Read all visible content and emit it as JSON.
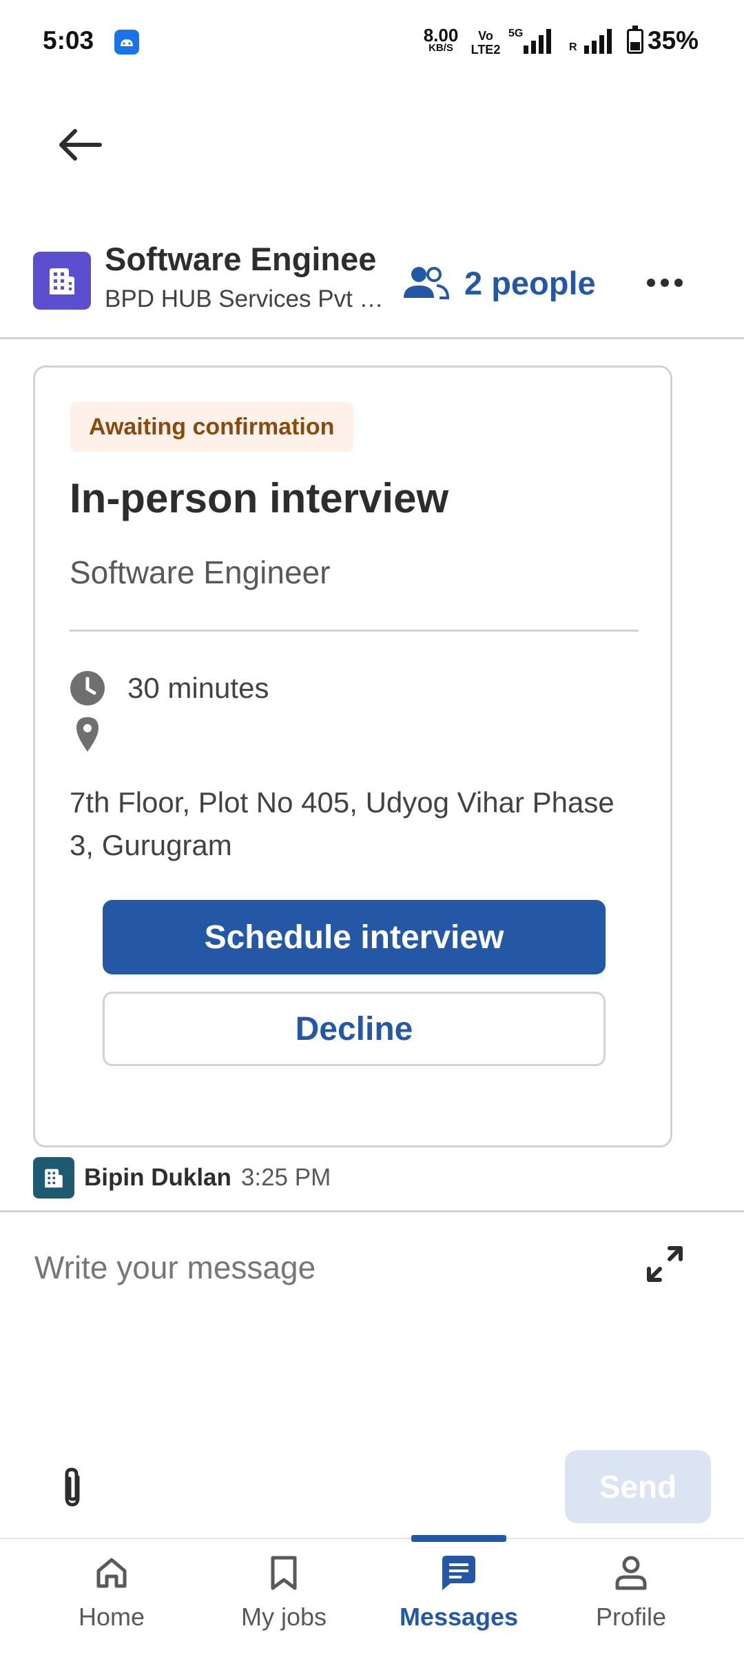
{
  "status_bar": {
    "time": "5:03",
    "network_speed": "8.00",
    "network_speed_unit": "KB/S",
    "volte": "Vo",
    "lte": "LTE2",
    "network_type": "5G",
    "roaming": "R",
    "battery": "35%"
  },
  "header": {
    "title": "Software Enginee",
    "company": "BPD HUB Services Pvt Ltd",
    "people_label": "2 people"
  },
  "card": {
    "status_badge": "Awaiting confirmation",
    "title": "In-person interview",
    "job_title": "Software Engineer",
    "duration": "30 minutes",
    "address": "7th Floor, Plot No 405, Udyog Vihar Phase 3, Gurugram",
    "primary_button": "Schedule interview",
    "secondary_button": "Decline"
  },
  "sender": {
    "name": "Bipin Duklan",
    "time": "3:25 PM"
  },
  "composer": {
    "placeholder": "Write your message",
    "send_label": "Send"
  },
  "nav": {
    "items": [
      {
        "label": "Home",
        "icon": "home-icon"
      },
      {
        "label": "My jobs",
        "icon": "bookmark-icon"
      },
      {
        "label": "Messages",
        "icon": "message-icon",
        "active": true
      },
      {
        "label": "Profile",
        "icon": "person-icon"
      }
    ]
  },
  "colors": {
    "primary": "#2557a7",
    "badge_bg": "#fef1ea",
    "badge_text": "#8a4a0b",
    "company_logo": "#5b4fcf",
    "sender_avatar": "#1f5a73"
  }
}
